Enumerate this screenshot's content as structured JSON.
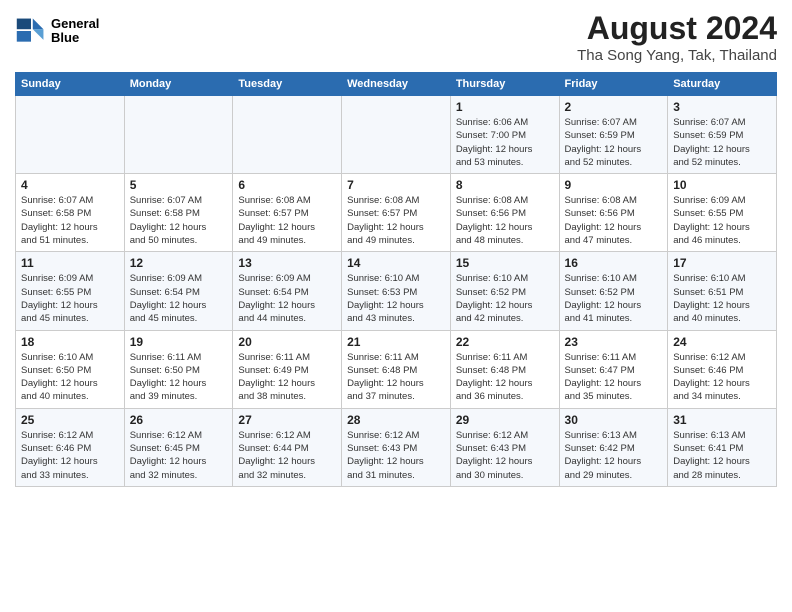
{
  "logo": {
    "line1": "General",
    "line2": "Blue"
  },
  "title": "August 2024",
  "subtitle": "Tha Song Yang, Tak, Thailand",
  "weekdays": [
    "Sunday",
    "Monday",
    "Tuesday",
    "Wednesday",
    "Thursday",
    "Friday",
    "Saturday"
  ],
  "weeks": [
    [
      {
        "day": "",
        "info": ""
      },
      {
        "day": "",
        "info": ""
      },
      {
        "day": "",
        "info": ""
      },
      {
        "day": "",
        "info": ""
      },
      {
        "day": "1",
        "info": "Sunrise: 6:06 AM\nSunset: 7:00 PM\nDaylight: 12 hours\nand 53 minutes."
      },
      {
        "day": "2",
        "info": "Sunrise: 6:07 AM\nSunset: 6:59 PM\nDaylight: 12 hours\nand 52 minutes."
      },
      {
        "day": "3",
        "info": "Sunrise: 6:07 AM\nSunset: 6:59 PM\nDaylight: 12 hours\nand 52 minutes."
      }
    ],
    [
      {
        "day": "4",
        "info": "Sunrise: 6:07 AM\nSunset: 6:58 PM\nDaylight: 12 hours\nand 51 minutes."
      },
      {
        "day": "5",
        "info": "Sunrise: 6:07 AM\nSunset: 6:58 PM\nDaylight: 12 hours\nand 50 minutes."
      },
      {
        "day": "6",
        "info": "Sunrise: 6:08 AM\nSunset: 6:57 PM\nDaylight: 12 hours\nand 49 minutes."
      },
      {
        "day": "7",
        "info": "Sunrise: 6:08 AM\nSunset: 6:57 PM\nDaylight: 12 hours\nand 49 minutes."
      },
      {
        "day": "8",
        "info": "Sunrise: 6:08 AM\nSunset: 6:56 PM\nDaylight: 12 hours\nand 48 minutes."
      },
      {
        "day": "9",
        "info": "Sunrise: 6:08 AM\nSunset: 6:56 PM\nDaylight: 12 hours\nand 47 minutes."
      },
      {
        "day": "10",
        "info": "Sunrise: 6:09 AM\nSunset: 6:55 PM\nDaylight: 12 hours\nand 46 minutes."
      }
    ],
    [
      {
        "day": "11",
        "info": "Sunrise: 6:09 AM\nSunset: 6:55 PM\nDaylight: 12 hours\nand 45 minutes."
      },
      {
        "day": "12",
        "info": "Sunrise: 6:09 AM\nSunset: 6:54 PM\nDaylight: 12 hours\nand 45 minutes."
      },
      {
        "day": "13",
        "info": "Sunrise: 6:09 AM\nSunset: 6:54 PM\nDaylight: 12 hours\nand 44 minutes."
      },
      {
        "day": "14",
        "info": "Sunrise: 6:10 AM\nSunset: 6:53 PM\nDaylight: 12 hours\nand 43 minutes."
      },
      {
        "day": "15",
        "info": "Sunrise: 6:10 AM\nSunset: 6:52 PM\nDaylight: 12 hours\nand 42 minutes."
      },
      {
        "day": "16",
        "info": "Sunrise: 6:10 AM\nSunset: 6:52 PM\nDaylight: 12 hours\nand 41 minutes."
      },
      {
        "day": "17",
        "info": "Sunrise: 6:10 AM\nSunset: 6:51 PM\nDaylight: 12 hours\nand 40 minutes."
      }
    ],
    [
      {
        "day": "18",
        "info": "Sunrise: 6:10 AM\nSunset: 6:50 PM\nDaylight: 12 hours\nand 40 minutes."
      },
      {
        "day": "19",
        "info": "Sunrise: 6:11 AM\nSunset: 6:50 PM\nDaylight: 12 hours\nand 39 minutes."
      },
      {
        "day": "20",
        "info": "Sunrise: 6:11 AM\nSunset: 6:49 PM\nDaylight: 12 hours\nand 38 minutes."
      },
      {
        "day": "21",
        "info": "Sunrise: 6:11 AM\nSunset: 6:48 PM\nDaylight: 12 hours\nand 37 minutes."
      },
      {
        "day": "22",
        "info": "Sunrise: 6:11 AM\nSunset: 6:48 PM\nDaylight: 12 hours\nand 36 minutes."
      },
      {
        "day": "23",
        "info": "Sunrise: 6:11 AM\nSunset: 6:47 PM\nDaylight: 12 hours\nand 35 minutes."
      },
      {
        "day": "24",
        "info": "Sunrise: 6:12 AM\nSunset: 6:46 PM\nDaylight: 12 hours\nand 34 minutes."
      }
    ],
    [
      {
        "day": "25",
        "info": "Sunrise: 6:12 AM\nSunset: 6:46 PM\nDaylight: 12 hours\nand 33 minutes."
      },
      {
        "day": "26",
        "info": "Sunrise: 6:12 AM\nSunset: 6:45 PM\nDaylight: 12 hours\nand 32 minutes."
      },
      {
        "day": "27",
        "info": "Sunrise: 6:12 AM\nSunset: 6:44 PM\nDaylight: 12 hours\nand 32 minutes."
      },
      {
        "day": "28",
        "info": "Sunrise: 6:12 AM\nSunset: 6:43 PM\nDaylight: 12 hours\nand 31 minutes."
      },
      {
        "day": "29",
        "info": "Sunrise: 6:12 AM\nSunset: 6:43 PM\nDaylight: 12 hours\nand 30 minutes."
      },
      {
        "day": "30",
        "info": "Sunrise: 6:13 AM\nSunset: 6:42 PM\nDaylight: 12 hours\nand 29 minutes."
      },
      {
        "day": "31",
        "info": "Sunrise: 6:13 AM\nSunset: 6:41 PM\nDaylight: 12 hours\nand 28 minutes."
      }
    ]
  ]
}
